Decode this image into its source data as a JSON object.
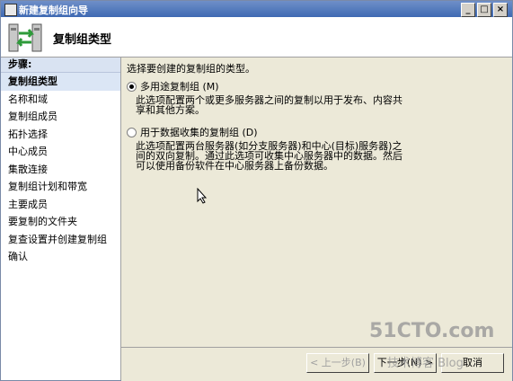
{
  "window": {
    "title": "新建复制组向导",
    "controls": [
      "_",
      "□",
      "×"
    ]
  },
  "header": {
    "title": "复制组类型"
  },
  "sidebar": {
    "heading": "步骤:",
    "items": [
      {
        "label": "复制组类型"
      },
      {
        "label": "名称和域"
      },
      {
        "label": "复制组成员"
      },
      {
        "label": "拓扑选择"
      },
      {
        "label": "中心成员"
      },
      {
        "label": "集散连接"
      },
      {
        "label": "复制组计划和带宽"
      },
      {
        "label": "主要成员"
      },
      {
        "label": "要复制的文件夹"
      },
      {
        "label": "复查设置并创建复制组"
      },
      {
        "label": "确认"
      }
    ]
  },
  "main": {
    "prompt": "选择要创建的复制组的类型。",
    "options": [
      {
        "label": "多用途复制组 (M)",
        "checked": true,
        "desc": "此选项配置两个或更多服务器之间的复制以用于发布、内容共享和其他方案。"
      },
      {
        "label": "用于数据收集的复制组 (D)",
        "checked": false,
        "desc": "此选项配置两台服务器(如分支服务器)和中心(目标)服务器)之间的双向复制。通过此选项可收集中心服务器中的数据。然后可以使用备份软件在中心服务器上备份数据。"
      }
    ]
  },
  "footer": {
    "back": "< 上一步(B)",
    "next": "下一步(N) >",
    "cancel": "取消"
  },
  "watermark": {
    "site": "51CTO.com",
    "sub": "技术博客 Blog"
  }
}
